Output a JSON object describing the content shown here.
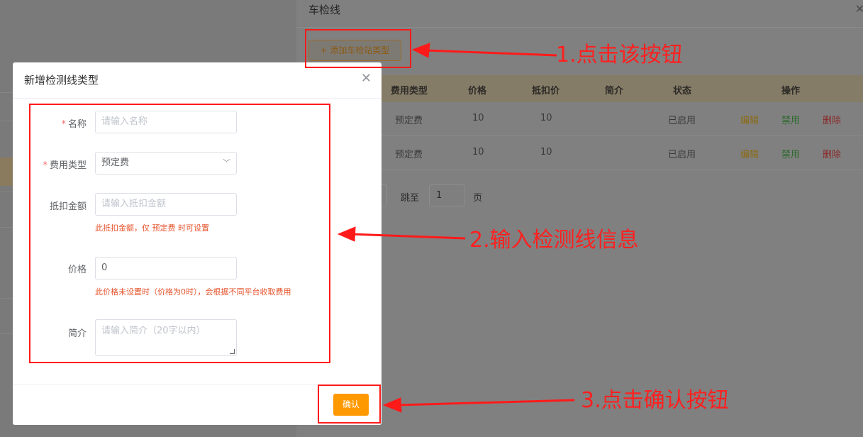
{
  "drawer": {
    "title": "车检线",
    "close_icon": "close-icon",
    "add_type_button": "+ 添加车检站类型",
    "table": {
      "headers": [
        "费用类型",
        "价格",
        "抵扣价",
        "简介",
        "状态",
        "操作"
      ],
      "rows": [
        {
          "fee_type": "预定费",
          "price": "10",
          "deduct_price": "10",
          "intro": "",
          "status": "已启用",
          "edit": "编辑",
          "disable": "禁用",
          "delete": "删除"
        },
        {
          "fee_type": "预定费",
          "price": "10",
          "deduct_price": "10",
          "intro": "",
          "status": "已启用",
          "edit": "编辑",
          "disable": "禁用",
          "delete": "删除"
        }
      ]
    },
    "pagination": {
      "goto_label": "跳至",
      "page_value": "1",
      "page_suffix": "页"
    }
  },
  "modal": {
    "title": "新增检测线类型",
    "close_icon": "close-icon",
    "fields": {
      "name": {
        "label": "名称",
        "required_mark": "*",
        "placeholder": "请输入名称"
      },
      "fee_type": {
        "label": "费用类型",
        "required_mark": "*",
        "value": "预定费",
        "arrow_icon": "chevron-down-icon"
      },
      "deduct_amount": {
        "label": "抵扣金额",
        "placeholder": "请输入抵扣金额",
        "hint": "此抵扣金额，仅 预定费 时可设置"
      },
      "price": {
        "label": "价格",
        "value": "0",
        "hint": "此价格未设置时（价格为0时），会根据不同平台收取费用"
      },
      "intro": {
        "label": "简介",
        "placeholder": "请输入简介（20字以内）"
      }
    },
    "confirm_button": "确认"
  },
  "annotations": {
    "step1": "1.点击该按钮",
    "step2": "2.输入检测线信息",
    "step3": "3.点击确认按钮",
    "color": "#ff2020"
  },
  "colors": {
    "primary": "#ff9900",
    "hint": "#e6552e",
    "required": "#f56c6c"
  }
}
